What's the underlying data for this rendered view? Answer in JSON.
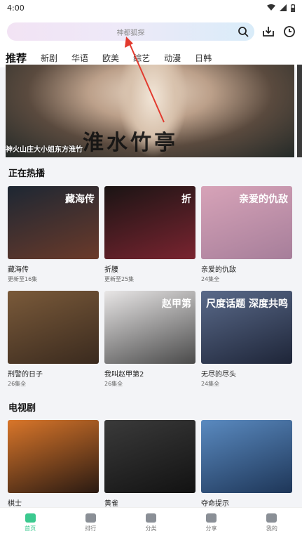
{
  "status_bar": {
    "time": "4:00"
  },
  "search": {
    "placeholder": "神都狐探"
  },
  "tabs": [
    "推荐",
    "新剧",
    "华语",
    "欧美",
    "综艺",
    "动漫",
    "日韩"
  ],
  "banner": {
    "caption": "神火山庄大小姐东方淮竹",
    "art_text": "淮水竹亭"
  },
  "sections": [
    {
      "title": "正在热播",
      "items": [
        {
          "title": "藏海传",
          "sub": "更新至16集",
          "poster_text": "藏海传",
          "colors": [
            "#1d2733",
            "#6b3a2a"
          ]
        },
        {
          "title": "折腰",
          "sub": "更新至25集",
          "poster_text": "折",
          "colors": [
            "#1a1414",
            "#7a2430"
          ]
        },
        {
          "title": "亲爱的仇敌",
          "sub": "24集全",
          "poster_text": "亲爱的仇敌",
          "colors": [
            "#d7a3b8",
            "#a67e9a"
          ]
        },
        {
          "title": "刑警的日子",
          "sub": "26集全",
          "poster_text": "",
          "colors": [
            "#7a5a3a",
            "#3a2a1e"
          ]
        },
        {
          "title": "我叫赵甲第2",
          "sub": "26集全",
          "poster_text": "赵甲第",
          "colors": [
            "#e8e6e6",
            "#4a4a4a"
          ]
        },
        {
          "title": "无尽的尽头",
          "sub": "24集全",
          "poster_text": "尺度话题 深度共鸣",
          "colors": [
            "#5a6a8a",
            "#1e2538"
          ]
        }
      ]
    },
    {
      "title": "电视剧",
      "items": [
        {
          "title": "棋士",
          "sub": "",
          "poster_text": "",
          "colors": [
            "#d9762a",
            "#2a1a12"
          ]
        },
        {
          "title": "黄雀",
          "sub": "",
          "poster_text": "",
          "colors": [
            "#3a3a3a",
            "#121212"
          ]
        },
        {
          "title": "夺命提示",
          "sub": "",
          "poster_text": "",
          "colors": [
            "#5a8ac0",
            "#1e3658"
          ]
        }
      ]
    }
  ],
  "bottom_nav": [
    {
      "label": "首页",
      "icon": "home-icon",
      "active": true
    },
    {
      "label": "排行",
      "icon": "ranking-icon",
      "active": false
    },
    {
      "label": "分类",
      "icon": "category-icon",
      "active": false
    },
    {
      "label": "分享",
      "icon": "share-icon",
      "active": false
    },
    {
      "label": "我的",
      "icon": "profile-icon",
      "active": false
    }
  ],
  "accent_color": "#3bc98f"
}
